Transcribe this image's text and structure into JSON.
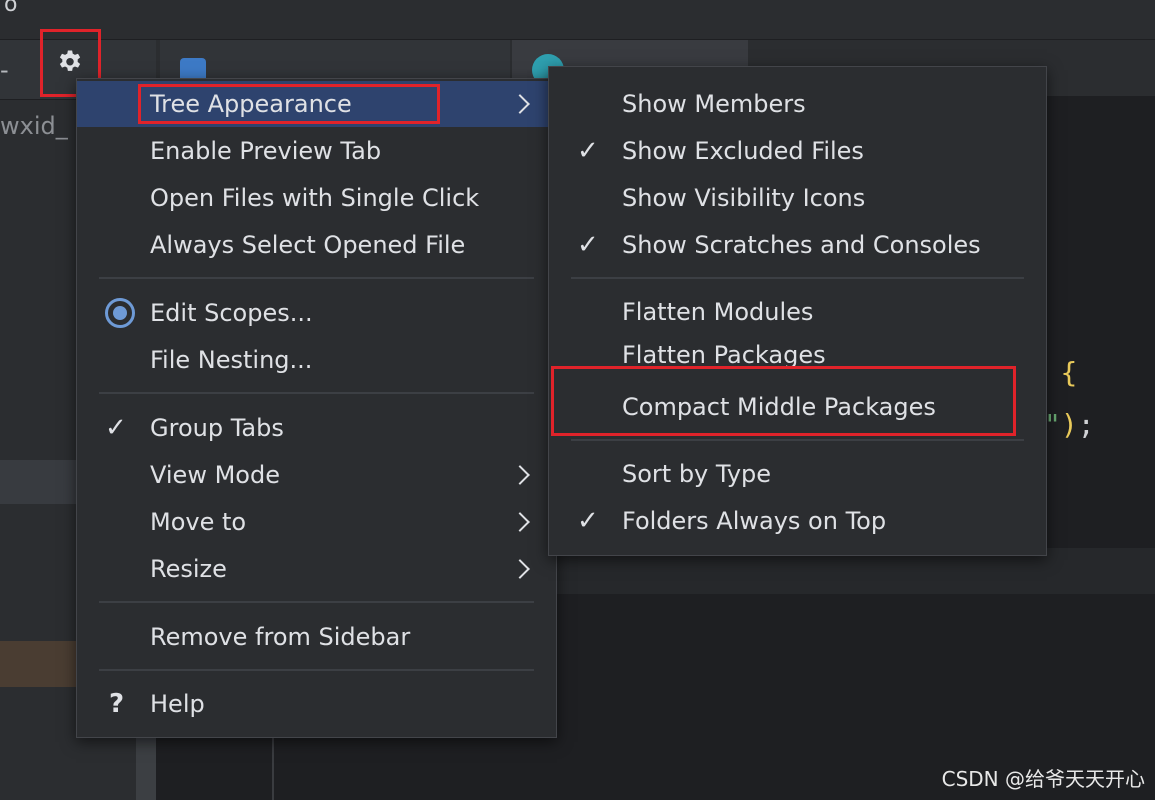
{
  "background": {
    "top_glyph": "o",
    "side_text": "wxid_",
    "code_brace": "{",
    "code_end_quote": "\"",
    "code_end_paren": ")",
    "code_end_semicolon": ";"
  },
  "colors": {
    "menu_bg": "#2b2d30",
    "selection": "#2e436e",
    "annotation_red": "#e0232a",
    "radio_accent": "#6e9ad6"
  },
  "main_menu": {
    "items": [
      {
        "label": "Tree Appearance",
        "has_submenu": true,
        "active": true
      },
      {
        "label": "Enable Preview Tab"
      },
      {
        "label": "Open Files with Single Click"
      },
      {
        "label": "Always Select Opened File"
      },
      {
        "label": "Edit Scopes...",
        "icon": "radio-selected-icon"
      },
      {
        "label": "File Nesting..."
      },
      {
        "label": "Group Tabs",
        "checked": true
      },
      {
        "label": "View Mode",
        "has_submenu": true
      },
      {
        "label": "Move to",
        "has_submenu": true
      },
      {
        "label": "Resize",
        "has_submenu": true
      },
      {
        "label": "Remove from Sidebar"
      },
      {
        "label": "Help",
        "icon": "help-icon",
        "icon_glyph": "?"
      }
    ]
  },
  "tree_appearance_menu": {
    "items": [
      {
        "label": "Show Members",
        "checked": false
      },
      {
        "label": "Show Excluded Files",
        "checked": true
      },
      {
        "label": "Show Visibility Icons",
        "checked": false
      },
      {
        "label": "Show Scratches and Consoles",
        "checked": true
      },
      {
        "label": "Flatten Modules",
        "checked": false
      },
      {
        "label": "Flatten Packages",
        "checked": false
      },
      {
        "label": "Compact Middle Packages",
        "checked": false
      },
      {
        "label": "Sort by Type",
        "checked": false
      },
      {
        "label": "Folders Always on Top",
        "checked": true
      }
    ]
  },
  "check_glyph": "✓",
  "watermark": "CSDN @给爷天天开心"
}
